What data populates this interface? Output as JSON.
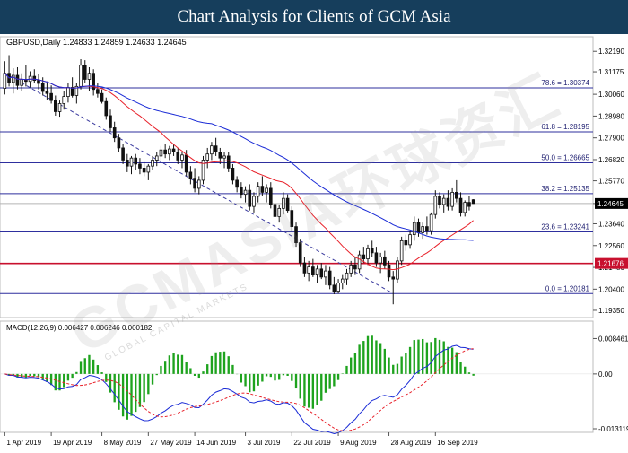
{
  "header": {
    "title": "Chart Analysis for Clients of GCM Asia"
  },
  "watermark": {
    "text": "GCMASIA环球资汇",
    "sub": "GLOBAL CAPITAL MARKETS"
  },
  "chart_data": {
    "type": "candlestick",
    "instrument_label": "GBPUSD,Daily  1.24833 1.24859 1.24633 1.24645",
    "price_axis": {
      "ylim": [
        1.1917,
        1.326
      ],
      "ticks": [
        "1.32190",
        "1.31175",
        "1.30060",
        "1.28980",
        "1.27900",
        "1.26820",
        "1.25770",
        "1.24645",
        "1.23640",
        "1.22560",
        "1.21480",
        "1.20400",
        "1.19350"
      ]
    },
    "x_tick_labels": [
      "1 Apr 2019",
      "19 Apr 2019",
      "8 May 2019",
      "27 May 2019",
      "14 Jun 2019",
      "3 Jul 2019",
      "22 Jul 2019",
      "9 Aug 2019",
      "28 Aug 2019",
      "16 Sep 2019"
    ],
    "fibonacci_levels": [
      {
        "label": "78.6  = 1.30374",
        "value": 1.30374
      },
      {
        "label": "61.8  = 1.28195",
        "value": 1.28195
      },
      {
        "label": "50.0  = 1.26665",
        "value": 1.26665
      },
      {
        "label": "38.2  = 1.25135",
        "value": 1.25135
      },
      {
        "label": "23.6  = 1.23241",
        "value": 1.23241
      },
      {
        "label": "0.0  = 1.20181",
        "value": 1.20181
      }
    ],
    "support_line": {
      "value": 1.21676,
      "label": "1.21676",
      "color": "#c8102e"
    },
    "current_price": {
      "value": 1.24645,
      "label": "1.24645"
    },
    "trendline": {
      "start": {
        "bar": 0,
        "price": 1.311
      },
      "end": {
        "bar": 92,
        "price": 1.2018
      }
    },
    "candles": [
      {
        "o": 1.3035,
        "h": 1.317,
        "l": 1.3005,
        "c": 1.311
      },
      {
        "o": 1.311,
        "h": 1.32,
        "l": 1.3045,
        "c": 1.3065
      },
      {
        "o": 1.3065,
        "h": 1.3135,
        "l": 1.301,
        "c": 1.31
      },
      {
        "o": 1.31,
        "h": 1.314,
        "l": 1.303,
        "c": 1.305
      },
      {
        "o": 1.305,
        "h": 1.311,
        "l": 1.302,
        "c": 1.308
      },
      {
        "o": 1.308,
        "h": 1.315,
        "l": 1.3045,
        "c": 1.307
      },
      {
        "o": 1.307,
        "h": 1.312,
        "l": 1.304,
        "c": 1.3095
      },
      {
        "o": 1.3095,
        "h": 1.313,
        "l": 1.306,
        "c": 1.3075
      },
      {
        "o": 1.3075,
        "h": 1.3105,
        "l": 1.303,
        "c": 1.306
      },
      {
        "o": 1.306,
        "h": 1.309,
        "l": 1.3,
        "c": 1.302
      },
      {
        "o": 1.302,
        "h": 1.307,
        "l": 1.298,
        "c": 1.301
      },
      {
        "o": 1.301,
        "h": 1.305,
        "l": 1.296,
        "c": 1.2975
      },
      {
        "o": 1.2975,
        "h": 1.3,
        "l": 1.29,
        "c": 1.292
      },
      {
        "o": 1.292,
        "h": 1.2975,
        "l": 1.2895,
        "c": 1.296
      },
      {
        "o": 1.296,
        "h": 1.302,
        "l": 1.293,
        "c": 1.2995
      },
      {
        "o": 1.2995,
        "h": 1.306,
        "l": 1.2965,
        "c": 1.304
      },
      {
        "o": 1.304,
        "h": 1.309,
        "l": 1.299,
        "c": 1.3
      },
      {
        "o": 1.3,
        "h": 1.306,
        "l": 1.296,
        "c": 1.3045
      },
      {
        "o": 1.3045,
        "h": 1.318,
        "l": 1.303,
        "c": 1.315
      },
      {
        "o": 1.315,
        "h": 1.3175,
        "l": 1.306,
        "c": 1.308
      },
      {
        "o": 1.308,
        "h": 1.314,
        "l": 1.302,
        "c": 1.311
      },
      {
        "o": 1.311,
        "h": 1.313,
        "l": 1.3,
        "c": 1.303
      },
      {
        "o": 1.303,
        "h": 1.306,
        "l": 1.299,
        "c": 1.301
      },
      {
        "o": 1.301,
        "h": 1.303,
        "l": 1.296,
        "c": 1.297
      },
      {
        "o": 1.297,
        "h": 1.299,
        "l": 1.288,
        "c": 1.29
      },
      {
        "o": 1.29,
        "h": 1.293,
        "l": 1.282,
        "c": 1.284
      },
      {
        "o": 1.284,
        "h": 1.287,
        "l": 1.277,
        "c": 1.279
      },
      {
        "o": 1.279,
        "h": 1.281,
        "l": 1.272,
        "c": 1.274
      },
      {
        "o": 1.274,
        "h": 1.276,
        "l": 1.266,
        "c": 1.268
      },
      {
        "o": 1.268,
        "h": 1.271,
        "l": 1.262,
        "c": 1.265
      },
      {
        "o": 1.265,
        "h": 1.27,
        "l": 1.261,
        "c": 1.269
      },
      {
        "o": 1.269,
        "h": 1.271,
        "l": 1.263,
        "c": 1.266
      },
      {
        "o": 1.266,
        "h": 1.269,
        "l": 1.261,
        "c": 1.264
      },
      {
        "o": 1.264,
        "h": 1.267,
        "l": 1.26,
        "c": 1.262
      },
      {
        "o": 1.262,
        "h": 1.266,
        "l": 1.258,
        "c": 1.265
      },
      {
        "o": 1.265,
        "h": 1.27,
        "l": 1.263,
        "c": 1.268
      },
      {
        "o": 1.268,
        "h": 1.272,
        "l": 1.265,
        "c": 1.27
      },
      {
        "o": 1.27,
        "h": 1.275,
        "l": 1.267,
        "c": 1.273
      },
      {
        "o": 1.273,
        "h": 1.276,
        "l": 1.269,
        "c": 1.271
      },
      {
        "o": 1.271,
        "h": 1.275,
        "l": 1.268,
        "c": 1.2735
      },
      {
        "o": 1.2735,
        "h": 1.276,
        "l": 1.27,
        "c": 1.272
      },
      {
        "o": 1.272,
        "h": 1.274,
        "l": 1.266,
        "c": 1.268
      },
      {
        "o": 1.268,
        "h": 1.272,
        "l": 1.264,
        "c": 1.2705
      },
      {
        "o": 1.2705,
        "h": 1.273,
        "l": 1.26,
        "c": 1.262
      },
      {
        "o": 1.262,
        "h": 1.265,
        "l": 1.256,
        "c": 1.259
      },
      {
        "o": 1.259,
        "h": 1.264,
        "l": 1.252,
        "c": 1.254
      },
      {
        "o": 1.254,
        "h": 1.26,
        "l": 1.251,
        "c": 1.258
      },
      {
        "o": 1.258,
        "h": 1.27,
        "l": 1.256,
        "c": 1.268
      },
      {
        "o": 1.268,
        "h": 1.274,
        "l": 1.264,
        "c": 1.271
      },
      {
        "o": 1.271,
        "h": 1.277,
        "l": 1.268,
        "c": 1.275
      },
      {
        "o": 1.275,
        "h": 1.279,
        "l": 1.27,
        "c": 1.272
      },
      {
        "o": 1.272,
        "h": 1.274,
        "l": 1.266,
        "c": 1.269
      },
      {
        "o": 1.269,
        "h": 1.272,
        "l": 1.264,
        "c": 1.27
      },
      {
        "o": 1.27,
        "h": 1.272,
        "l": 1.262,
        "c": 1.264
      },
      {
        "o": 1.264,
        "h": 1.266,
        "l": 1.256,
        "c": 1.258
      },
      {
        "o": 1.258,
        "h": 1.26,
        "l": 1.252,
        "c": 1.2545
      },
      {
        "o": 1.2545,
        "h": 1.257,
        "l": 1.249,
        "c": 1.251
      },
      {
        "o": 1.251,
        "h": 1.255,
        "l": 1.247,
        "c": 1.253
      },
      {
        "o": 1.253,
        "h": 1.256,
        "l": 1.243,
        "c": 1.245
      },
      {
        "o": 1.245,
        "h": 1.252,
        "l": 1.242,
        "c": 1.25
      },
      {
        "o": 1.25,
        "h": 1.257,
        "l": 1.247,
        "c": 1.255
      },
      {
        "o": 1.255,
        "h": 1.26,
        "l": 1.25,
        "c": 1.252
      },
      {
        "o": 1.252,
        "h": 1.256,
        "l": 1.247,
        "c": 1.254
      },
      {
        "o": 1.254,
        "h": 1.257,
        "l": 1.244,
        "c": 1.246
      },
      {
        "o": 1.246,
        "h": 1.249,
        "l": 1.238,
        "c": 1.24
      },
      {
        "o": 1.24,
        "h": 1.246,
        "l": 1.237,
        "c": 1.244
      },
      {
        "o": 1.244,
        "h": 1.252,
        "l": 1.241,
        "c": 1.249
      },
      {
        "o": 1.249,
        "h": 1.251,
        "l": 1.242,
        "c": 1.243
      },
      {
        "o": 1.243,
        "h": 1.245,
        "l": 1.233,
        "c": 1.235
      },
      {
        "o": 1.235,
        "h": 1.237,
        "l": 1.225,
        "c": 1.227
      },
      {
        "o": 1.227,
        "h": 1.229,
        "l": 1.215,
        "c": 1.217
      },
      {
        "o": 1.217,
        "h": 1.22,
        "l": 1.21,
        "c": 1.212
      },
      {
        "o": 1.212,
        "h": 1.218,
        "l": 1.208,
        "c": 1.215
      },
      {
        "o": 1.215,
        "h": 1.219,
        "l": 1.21,
        "c": 1.211
      },
      {
        "o": 1.211,
        "h": 1.216,
        "l": 1.207,
        "c": 1.214
      },
      {
        "o": 1.214,
        "h": 1.217,
        "l": 1.209,
        "c": 1.21
      },
      {
        "o": 1.21,
        "h": 1.216,
        "l": 1.206,
        "c": 1.213
      },
      {
        "o": 1.213,
        "h": 1.215,
        "l": 1.204,
        "c": 1.206
      },
      {
        "o": 1.206,
        "h": 1.21,
        "l": 1.2015,
        "c": 1.203
      },
      {
        "o": 1.203,
        "h": 1.209,
        "l": 1.2018,
        "c": 1.207
      },
      {
        "o": 1.207,
        "h": 1.211,
        "l": 1.204,
        "c": 1.209
      },
      {
        "o": 1.209,
        "h": 1.214,
        "l": 1.206,
        "c": 1.212
      },
      {
        "o": 1.212,
        "h": 1.218,
        "l": 1.21,
        "c": 1.216
      },
      {
        "o": 1.216,
        "h": 1.22,
        "l": 1.211,
        "c": 1.214
      },
      {
        "o": 1.214,
        "h": 1.223,
        "l": 1.212,
        "c": 1.221
      },
      {
        "o": 1.221,
        "h": 1.225,
        "l": 1.217,
        "c": 1.219
      },
      {
        "o": 1.219,
        "h": 1.226,
        "l": 1.216,
        "c": 1.224
      },
      {
        "o": 1.224,
        "h": 1.228,
        "l": 1.22,
        "c": 1.222
      },
      {
        "o": 1.222,
        "h": 1.225,
        "l": 1.215,
        "c": 1.217
      },
      {
        "o": 1.217,
        "h": 1.222,
        "l": 1.212,
        "c": 1.22
      },
      {
        "o": 1.22,
        "h": 1.223,
        "l": 1.214,
        "c": 1.216
      },
      {
        "o": 1.216,
        "h": 1.218,
        "l": 1.208,
        "c": 1.21
      },
      {
        "o": 1.21,
        "h": 1.213,
        "l": 1.1965,
        "c": 1.209
      },
      {
        "o": 1.209,
        "h": 1.22,
        "l": 1.207,
        "c": 1.218
      },
      {
        "o": 1.218,
        "h": 1.23,
        "l": 1.216,
        "c": 1.228
      },
      {
        "o": 1.228,
        "h": 1.231,
        "l": 1.223,
        "c": 1.226
      },
      {
        "o": 1.226,
        "h": 1.233,
        "l": 1.224,
        "c": 1.231
      },
      {
        "o": 1.231,
        "h": 1.24,
        "l": 1.228,
        "c": 1.237
      },
      {
        "o": 1.237,
        "h": 1.239,
        "l": 1.23,
        "c": 1.232
      },
      {
        "o": 1.232,
        "h": 1.237,
        "l": 1.229,
        "c": 1.235
      },
      {
        "o": 1.235,
        "h": 1.24,
        "l": 1.231,
        "c": 1.233
      },
      {
        "o": 1.233,
        "h": 1.242,
        "l": 1.231,
        "c": 1.241
      },
      {
        "o": 1.241,
        "h": 1.253,
        "l": 1.239,
        "c": 1.25
      },
      {
        "o": 1.25,
        "h": 1.252,
        "l": 1.244,
        "c": 1.246
      },
      {
        "o": 1.246,
        "h": 1.251,
        "l": 1.242,
        "c": 1.249
      },
      {
        "o": 1.249,
        "h": 1.253,
        "l": 1.243,
        "c": 1.245
      },
      {
        "o": 1.245,
        "h": 1.254,
        "l": 1.243,
        "c": 1.252
      },
      {
        "o": 1.252,
        "h": 1.258,
        "l": 1.247,
        "c": 1.249
      },
      {
        "o": 1.249,
        "h": 1.252,
        "l": 1.24,
        "c": 1.242
      },
      {
        "o": 1.242,
        "h": 1.248,
        "l": 1.24,
        "c": 1.247
      },
      {
        "o": 1.247,
        "h": 1.25,
        "l": 1.243,
        "c": 1.245
      },
      {
        "o": 1.24833,
        "h": 1.24859,
        "l": 1.24633,
        "c": 1.24645
      }
    ],
    "overlays": [
      {
        "name": "red-ma",
        "color": "#e8212a",
        "period": 20
      },
      {
        "name": "blue-ma",
        "color": "#1a2bd6",
        "period": 50
      }
    ],
    "macd": {
      "label": "MACD(12,26,9) 0.006427 0.006246 0.000182",
      "ylim": [
        -0.013119,
        0.0092
      ],
      "ticks": [
        "0.008461",
        "0.00",
        "-0.013119"
      ],
      "macd_color": "#1a2bd6",
      "signal_color": "#e8212a",
      "hist_color": "#1ea31e"
    }
  }
}
